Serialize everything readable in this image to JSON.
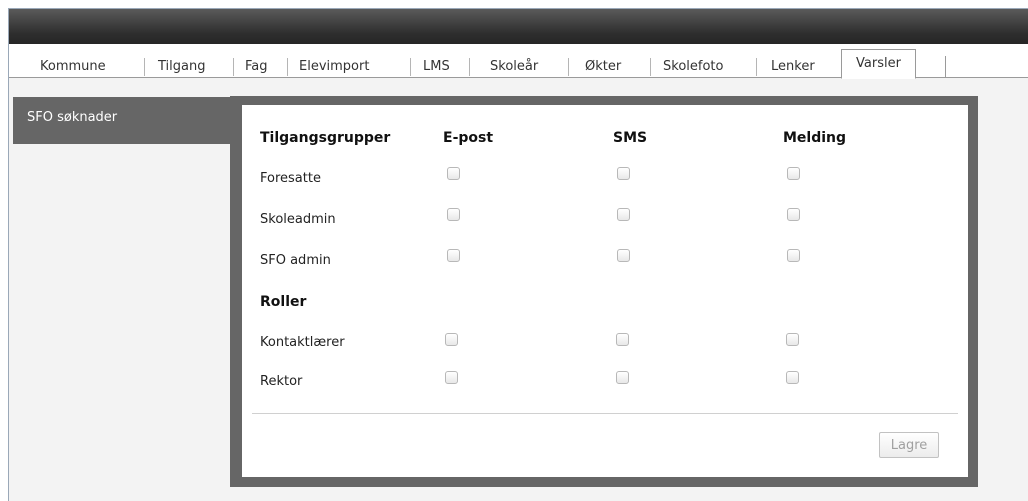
{
  "tabs": [
    {
      "label": "Kommune"
    },
    {
      "label": "Tilgang"
    },
    {
      "label": "Fag"
    },
    {
      "label": "Elevimport"
    },
    {
      "label": "LMS"
    },
    {
      "label": "Skoleår"
    },
    {
      "label": "Økter"
    },
    {
      "label": "Skolefoto"
    },
    {
      "label": "Lenker"
    },
    {
      "label": "Varsler",
      "active": true
    }
  ],
  "sidebar": {
    "items": [
      {
        "label": "SFO søknader",
        "active": true
      }
    ]
  },
  "form": {
    "headers": {
      "group": "Tilgangsgrupper",
      "email": "E-post",
      "sms": "SMS",
      "message": "Melding"
    },
    "access_groups": [
      {
        "label": "Foresatte",
        "email": false,
        "sms": false,
        "message": false
      },
      {
        "label": "Skoleadmin",
        "email": false,
        "sms": false,
        "message": false
      },
      {
        "label": "SFO admin",
        "email": false,
        "sms": false,
        "message": false
      }
    ],
    "roles_heading": "Roller",
    "roles": [
      {
        "label": "Kontaktlærer",
        "email": false,
        "sms": false,
        "message": false
      },
      {
        "label": "Rektor",
        "email": false,
        "sms": false,
        "message": false
      }
    ],
    "save_label": "Lagre",
    "save_disabled": true
  }
}
